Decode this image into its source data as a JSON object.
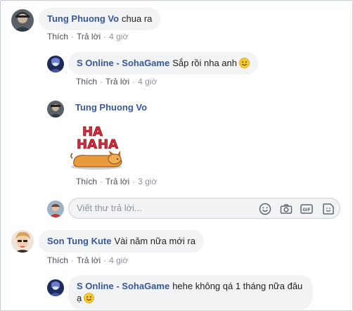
{
  "comments": [
    {
      "author": "Tung Phuong Vo",
      "text": "chua ra",
      "actions": {
        "like": "Thích",
        "reply": "Trả lời",
        "time": "4 giờ"
      }
    },
    {
      "author": "S Online - SohaGame",
      "text": "Sắp rồi nha anh",
      "emoji": "smiley-emoji",
      "actions": {
        "like": "Thích",
        "reply": "Trả lời",
        "time": "4 giờ"
      }
    },
    {
      "author": "Tung Phuong Vo",
      "sticker": "haha-dog-sticker",
      "sticker_text": [
        "HA",
        "HA",
        "HA"
      ],
      "actions": {
        "like": "Thích",
        "reply": "Trả lời",
        "time": "3 giờ"
      }
    },
    {
      "author": "Son Tung Kute",
      "text": "Vài năm nữa mới ra",
      "actions": {
        "like": "Thích",
        "reply": "Trả lời",
        "time": "4 giờ"
      }
    },
    {
      "author": "S Online - SohaGame",
      "text": "hehe không qá 1 tháng nữa đâu ạ",
      "emoji": "smiley-emoji"
    }
  ],
  "reply_box": {
    "placeholder": "Viết thư trả lời...",
    "icons": [
      "emoji-icon",
      "camera-icon",
      "gif-icon",
      "sticker-icon"
    ]
  },
  "colors": {
    "author": "#385898",
    "bubble": "#f2f3f5",
    "meta": "#606770"
  }
}
